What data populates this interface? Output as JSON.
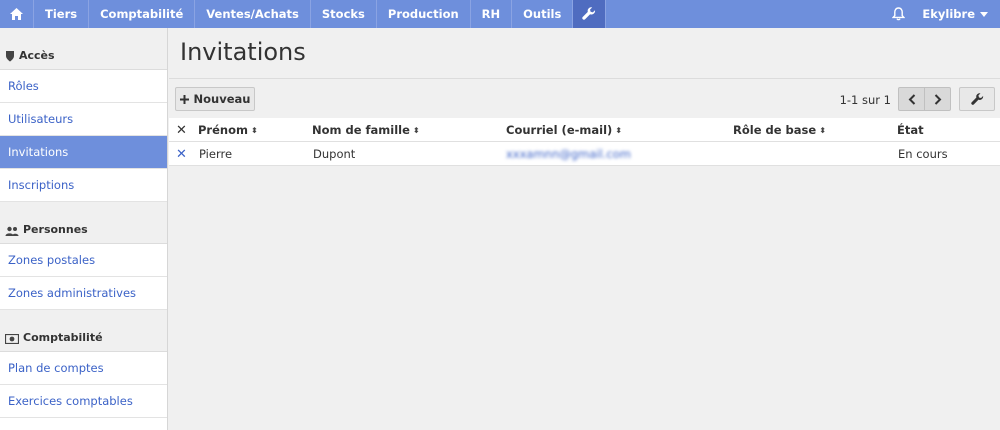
{
  "topnav": {
    "items": [
      {
        "label": "Tiers"
      },
      {
        "label": "Comptabilité"
      },
      {
        "label": "Ventes/Achats"
      },
      {
        "label": "Stocks"
      },
      {
        "label": "Production"
      },
      {
        "label": "RH"
      },
      {
        "label": "Outils"
      }
    ],
    "user": "Ekylibre"
  },
  "sidebar": {
    "sections": [
      {
        "title": "Accès",
        "items": [
          "Rôles",
          "Utilisateurs",
          "Invitations",
          "Inscriptions"
        ]
      },
      {
        "title": "Personnes",
        "items": [
          "Zones postales",
          "Zones administratives"
        ]
      },
      {
        "title": "Comptabilité",
        "items": [
          "Plan de comptes",
          "Exercices comptables"
        ]
      }
    ],
    "active_item": "Invitations"
  },
  "main": {
    "title": "Invitations",
    "new_label": "Nouveau",
    "pagination": "1-1 sur 1",
    "table": {
      "headers": [
        "Prénom",
        "Nom de famille",
        "Courriel (e-mail)",
        "Rôle de base",
        "État"
      ],
      "rows": [
        {
          "first_name": "Pierre",
          "last_name": "Dupont",
          "email": "xxxamnn@gmail.com",
          "role": "",
          "state": "En cours"
        }
      ]
    }
  },
  "colors": {
    "accent": "#6e8fdc",
    "active_nav": "#4f6cc0",
    "link": "#3b62c7"
  }
}
